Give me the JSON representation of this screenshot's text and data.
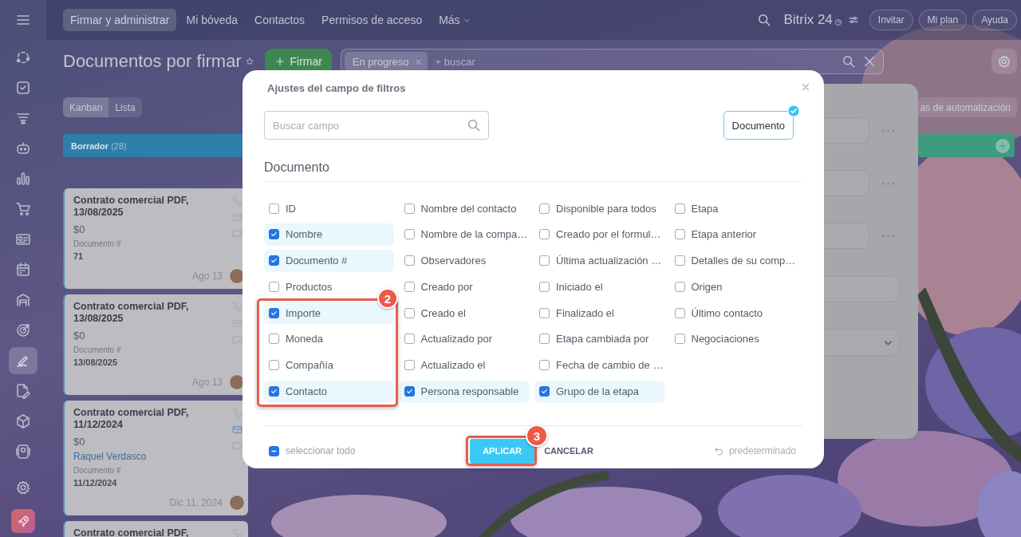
{
  "sidebar": {
    "items": [
      {
        "selected": false
      },
      {
        "selected": false
      },
      {
        "selected": false
      },
      {
        "selected": false
      },
      {
        "selected": false
      },
      {
        "selected": false
      },
      {
        "selected": false
      },
      {
        "selected": false
      },
      {
        "selected": false
      },
      {
        "selected": false
      },
      {
        "selected": true
      },
      {
        "selected": false
      },
      {
        "selected": false
      },
      {
        "selected": false
      }
    ],
    "footer_items": [
      {
        "selected": false
      },
      {
        "selected": false
      }
    ]
  },
  "top_nav": {
    "tabs": [
      {
        "label": "Firmar y administrar",
        "selected": true,
        "kind": "link"
      },
      {
        "label": "Mi bóveda",
        "selected": false,
        "kind": "link"
      },
      {
        "label": "Contactos",
        "selected": false,
        "kind": "link"
      },
      {
        "label": "Permisos de acceso",
        "selected": false,
        "kind": "link"
      },
      {
        "label": "Más",
        "selected": false,
        "kind": "menu"
      }
    ],
    "brand": "Bitrix 24",
    "buttons": [
      "Invitar",
      "Mi plan",
      "Ayuda"
    ]
  },
  "header": {
    "title": "Documentos por firmar",
    "create_button": "Firmar",
    "filter": {
      "chips": [
        {
          "label": "En progreso"
        }
      ],
      "placeholder": "+ buscar"
    },
    "views": [
      {
        "label": "Kanban",
        "selected": true
      },
      {
        "label": "Lista",
        "selected": false
      }
    ],
    "automation_button": "as de automatización"
  },
  "kanban": {
    "columns": [
      {
        "title": "Borrador",
        "count": "(28)",
        "color": "#2d7ea9",
        "cards": [
          {
            "title": "Contrato comercial PDF, 13/08/2025",
            "amount": "$0",
            "field_label": "Documento #",
            "field_value": "71",
            "date": "Ago 13",
            "mail_active": false
          },
          {
            "title": "Contrato comercial PDF, 13/08/2025",
            "amount": "$0",
            "field_label": "Documento #",
            "field_value": "13/08/2025",
            "date": "Ago 13",
            "mail_active": false
          },
          {
            "title": "Contrato comercial PDF, 11/12/2024",
            "amount": "$0",
            "contact": "Raquel Verdasco",
            "field_label": "Documento #",
            "field_value": "11/12/2024",
            "date": "Dic 11, 2024",
            "mail_active": true
          },
          {
            "title": "Contrato comercial PDF,"
          }
        ]
      },
      {
        "color": "#3f9a7f"
      }
    ]
  },
  "modal": {
    "title": "Ajustes del campo de filtros",
    "search_placeholder": "Buscar campo",
    "section_tabs": [
      {
        "label": "Documento",
        "selected": true
      }
    ],
    "section_title": "Documento",
    "field_columns": [
      {
        "fields": [
          {
            "label": "ID",
            "checked": false
          },
          {
            "label": "Nombre",
            "checked": true
          },
          {
            "label": "Documento #",
            "checked": true
          },
          {
            "label": "Productos",
            "checked": false
          },
          {
            "label": "Importe",
            "checked": true
          },
          {
            "label": "Moneda",
            "checked": false
          },
          {
            "label": "Compañía",
            "checked": false
          },
          {
            "label": "Contacto",
            "checked": true
          }
        ]
      },
      {
        "fields": [
          {
            "label": "Nombre del contacto",
            "checked": false
          },
          {
            "label": "Nombre de la compa…",
            "checked": false
          },
          {
            "label": "Observadores",
            "checked": false
          },
          {
            "label": "Creado por",
            "checked": false
          },
          {
            "label": "Creado el",
            "checked": false
          },
          {
            "label": "Actualizado por",
            "checked": false
          },
          {
            "label": "Actualizado el",
            "checked": false
          },
          {
            "label": "Persona responsable",
            "checked": true
          }
        ]
      },
      {
        "fields": [
          {
            "label": "Disponible para todos",
            "checked": false
          },
          {
            "label": "Creado por el formul…",
            "checked": false
          },
          {
            "label": "Última actualización …",
            "checked": false
          },
          {
            "label": "Iniciado el",
            "checked": false
          },
          {
            "label": "Finalizado el",
            "checked": false
          },
          {
            "label": "Etapa cambiada por",
            "checked": false
          },
          {
            "label": "Fecha de cambio de …",
            "checked": false
          },
          {
            "label": "Grupo de la etapa",
            "checked": true
          }
        ]
      },
      {
        "fields": [
          {
            "label": "Etapa",
            "checked": false
          },
          {
            "label": "Etapa anterior",
            "checked": false
          },
          {
            "label": "Detalles de su comp…",
            "checked": false
          },
          {
            "label": "Origen",
            "checked": false
          },
          {
            "label": "Último contacto",
            "checked": false
          },
          {
            "label": "Negociaciones",
            "checked": false
          }
        ]
      }
    ],
    "select_all": {
      "label": "seleccionar todo",
      "indeterminate": true
    },
    "apply_button": "APLICAR",
    "cancel_button": "CANCELAR",
    "reset_button": "predeterminado",
    "callouts": [
      {
        "number": "2"
      },
      {
        "number": "3"
      }
    ]
  }
}
